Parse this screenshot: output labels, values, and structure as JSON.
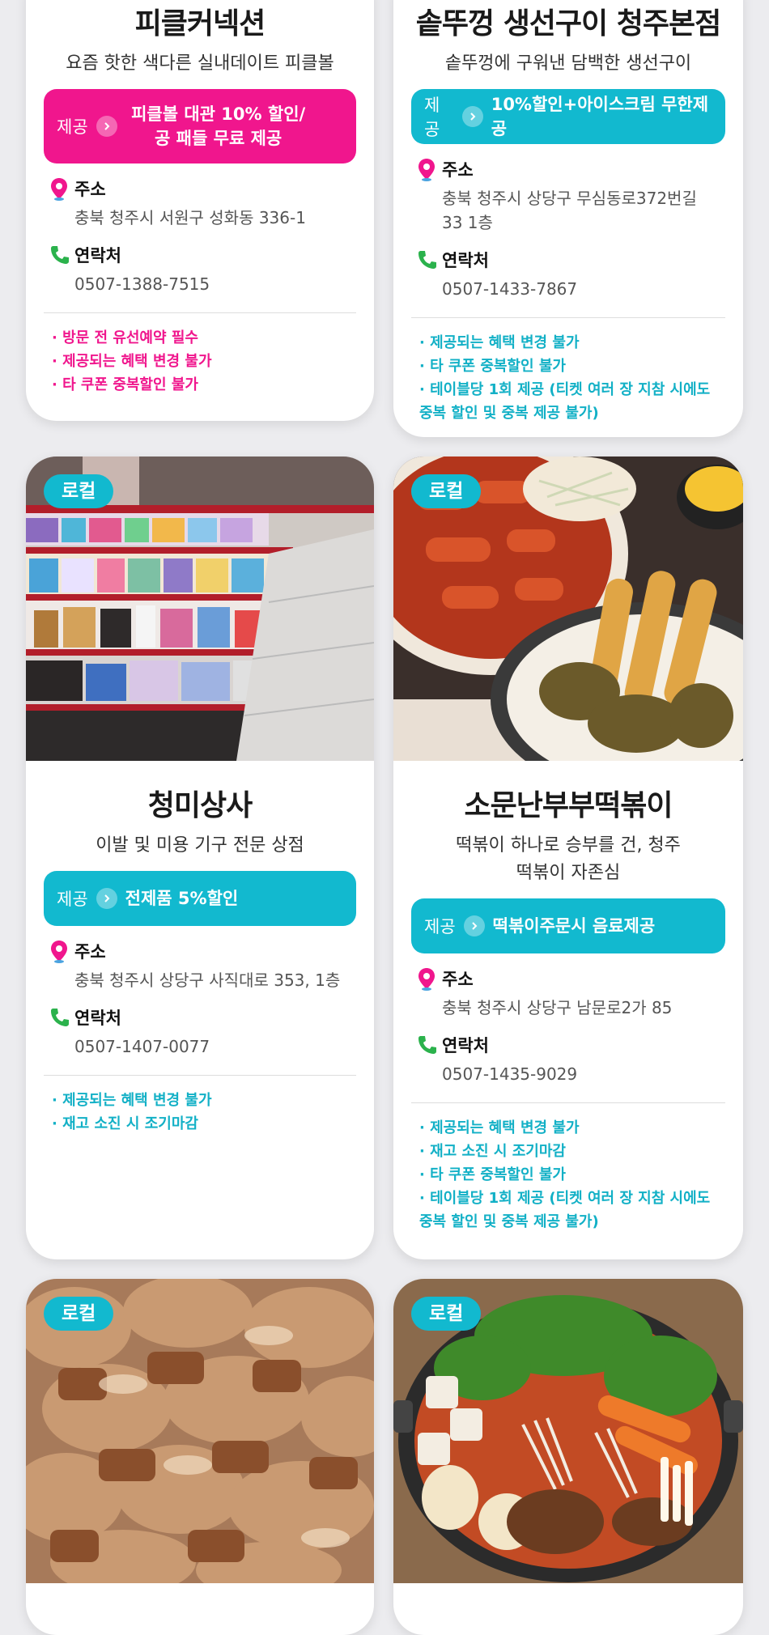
{
  "cards": [
    {
      "title": "피클커넥션",
      "desc": "요즘 핫한 색다른 실내데이트 피클볼",
      "offer_label": "제공",
      "offer_text": "피클볼 대관 10% 할인/ 공 패들 무료 제공",
      "address_label": "주소",
      "address": "충북 청주시 서원구 성화동 336-1",
      "contact_label": "연락처",
      "phone": "0507-1388-7515",
      "notes": [
        "· 방문 전 유선예약 필수",
        "· 제공되는 혜택 변경 불가",
        "· 타 쿠폰 중복할인 불가"
      ],
      "accent": "#f0168d"
    },
    {
      "title": "솥뚜껑 생선구이 청주본점",
      "desc": "솥뚜껑에 구워낸 담백한 생선구이",
      "offer_label": "제공",
      "offer_text": "10%할인+아이스크림 무한제공",
      "address_label": "주소",
      "address": "충북 청주시 상당구 무심동로372번길 33 1층",
      "contact_label": "연락처",
      "phone": "0507-1433-7867",
      "notes": [
        "· 제공되는 혜택 변경 불가",
        "· 타 쿠폰 중복할인 불가",
        "· 테이블당 1회 제공 (티켓 여러 장 지참 시에도 중복 할인 및 중복 제공 불가)"
      ],
      "accent": "#12b9cf"
    },
    {
      "badge": "로컬",
      "photo": "beauty-store-shelves",
      "title": "청미상사",
      "desc": "이발 및 미용 기구 전문 상점",
      "offer_label": "제공",
      "offer_text": "전제품 5%할인",
      "address_label": "주소",
      "address": "충북 청주시 상당구 사직대로 353, 1층",
      "contact_label": "연락처",
      "phone": "0507-1407-0077",
      "notes": [
        "· 제공되는 혜택 변경 불가",
        "· 재고 소진 시 조기마감"
      ],
      "accent": "#12b9cf"
    },
    {
      "badge": "로컬",
      "photo": "tteokbokki-and-fried-food",
      "title": "소문난부부떡볶이",
      "desc": "떡볶이 하나로 승부를 건, 청주 떡볶이 자존심",
      "offer_label": "제공",
      "offer_text": "떡볶이주문시 음료제공",
      "address_label": "주소",
      "address": "충북 청주시 상당구 남문로2가 85",
      "contact_label": "연락처",
      "phone": "0507-1435-9029",
      "notes": [
        "· 제공되는 혜택 변경 불가",
        "· 재고 소진 시 조기마감",
        "· 타 쿠폰 중복할인 불가",
        "· 테이블당 1회 제공 (티켓 여러 장 지참 시에도 중복 할인 및 중복 제공 불가)"
      ],
      "accent": "#12b9cf"
    },
    {
      "badge": "로컬",
      "photo": "grilled-pork"
    },
    {
      "badge": "로컬",
      "photo": "spicy-stew-hotpot"
    }
  ]
}
